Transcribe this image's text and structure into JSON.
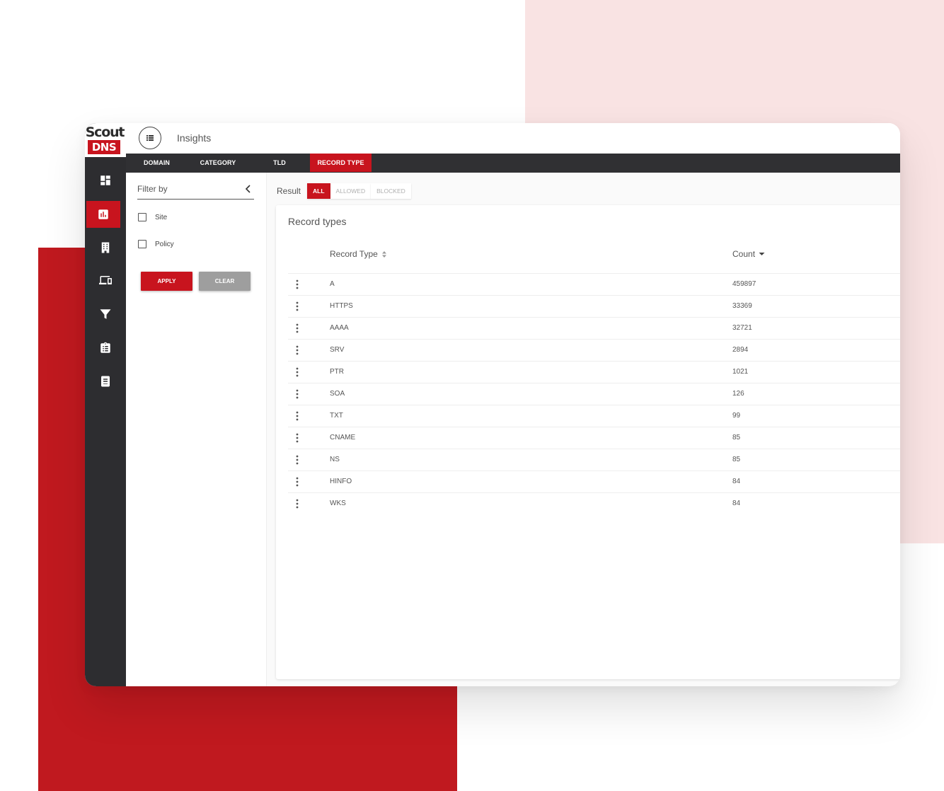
{
  "app": {
    "logo_top": "Scout",
    "logo_bottom": "DNS",
    "page_title": "Insights",
    "brand_red": "#c8141e",
    "rail_dark": "#2d2d30"
  },
  "sidebar": {
    "items": [
      {
        "icon": "dashboard-icon",
        "active": false
      },
      {
        "icon": "bar-chart-icon",
        "active": true
      },
      {
        "icon": "building-icon",
        "active": false
      },
      {
        "icon": "devices-icon",
        "active": false
      },
      {
        "icon": "filter-icon",
        "active": false
      },
      {
        "icon": "clipboard-icon",
        "active": false
      },
      {
        "icon": "book-icon",
        "active": false
      }
    ]
  },
  "tabs": [
    {
      "label": "DOMAIN",
      "active": false
    },
    {
      "label": "CATEGORY",
      "active": false
    },
    {
      "label": "TLD",
      "active": false
    },
    {
      "label": "RECORD TYPE",
      "active": true
    }
  ],
  "filter": {
    "title": "Filter by",
    "options": [
      {
        "label": "Site",
        "checked": false
      },
      {
        "label": "Policy",
        "checked": false
      }
    ],
    "apply_label": "APPLY",
    "clear_label": "CLEAR"
  },
  "result": {
    "label": "Result",
    "options": [
      {
        "label": "ALL",
        "active": true
      },
      {
        "label": "ALLOWED",
        "active": false
      },
      {
        "label": "BLOCKED",
        "active": false
      }
    ]
  },
  "table": {
    "title": "Record types",
    "columns": {
      "type": "Record Type",
      "count": "Count"
    },
    "rows": [
      {
        "type": "A",
        "count": "459897"
      },
      {
        "type": "HTTPS",
        "count": "33369"
      },
      {
        "type": "AAAA",
        "count": "32721"
      },
      {
        "type": "SRV",
        "count": "2894"
      },
      {
        "type": "PTR",
        "count": "1021"
      },
      {
        "type": "SOA",
        "count": "126"
      },
      {
        "type": "TXT",
        "count": "99"
      },
      {
        "type": "CNAME",
        "count": "85"
      },
      {
        "type": "NS",
        "count": "85"
      },
      {
        "type": "HINFO",
        "count": "84"
      },
      {
        "type": "WKS",
        "count": "84"
      }
    ]
  }
}
